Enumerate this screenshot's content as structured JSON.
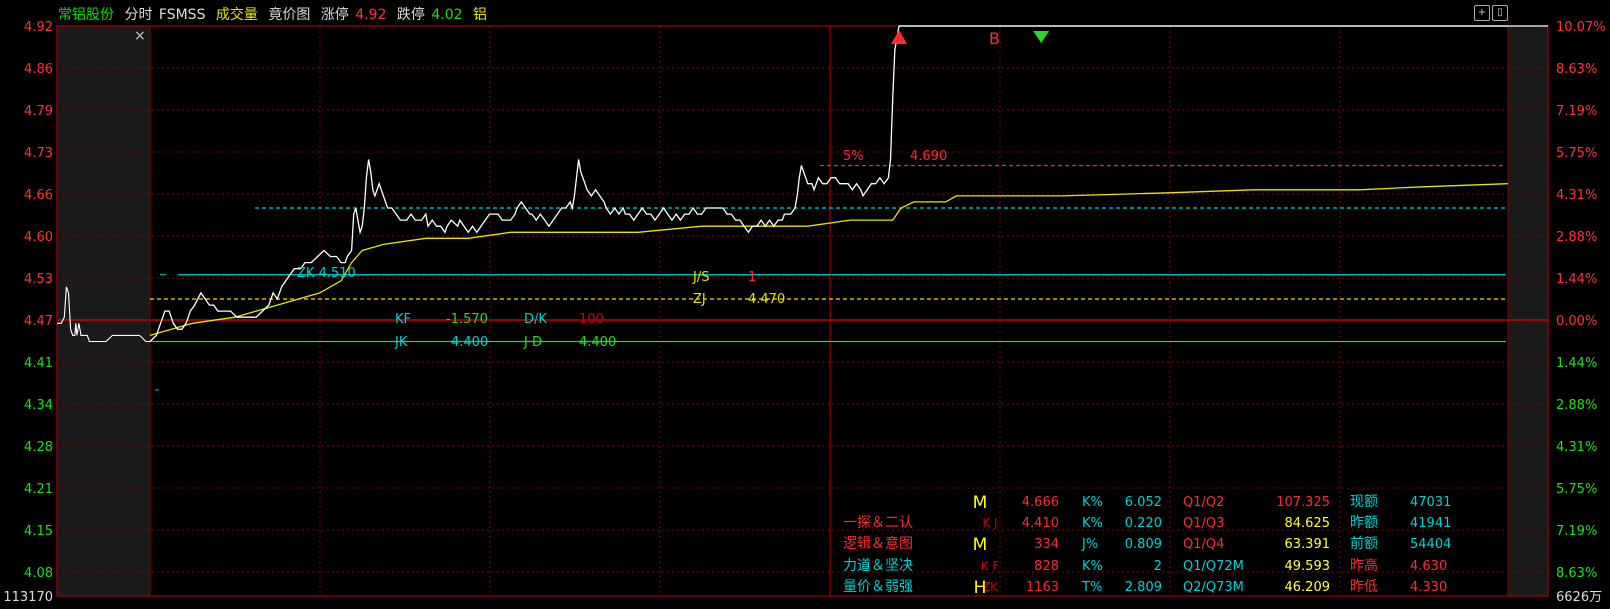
{
  "header": {
    "stock_name": "常铝股份",
    "mode": "分时",
    "indicator": "FSMSS",
    "volume_label": "成交量",
    "auction_label": "竟价图",
    "limit_up_label": "涨停",
    "limit_up_value": "4.92",
    "limit_down_label": "跌停",
    "limit_down_value": "4.02",
    "suffix": "铝"
  },
  "buttons": {
    "close": "×",
    "add": "+",
    "window": "▯"
  },
  "colors": {
    "background": "#000000",
    "grid": "#8b0000",
    "price_line": "#ffffff",
    "avg_line": "#e6e600",
    "up": "#ff2a2a",
    "down": "#22dd22",
    "cyan": "#00d2d2",
    "yellow": "#ffff44"
  },
  "chart_data": {
    "type": "line",
    "title": "",
    "xlabel": "",
    "ylabel": "",
    "prev_close": 4.47,
    "ylim": [
      4.02,
      4.92
    ],
    "left_ticks": [
      "4.92",
      "4.86",
      "4.79",
      "4.73",
      "4.66",
      "4.60",
      "4.53",
      "4.47",
      "4.41",
      "4.34",
      "4.28",
      "4.21",
      "4.15",
      "4.08",
      "113170"
    ],
    "right_ticks": [
      "10.07%",
      "8.63%",
      "7.19%",
      "5.75%",
      "4.31%",
      "2.88%",
      "1.44%",
      "0.00%",
      "1.44%",
      "2.88%",
      "4.31%",
      "5.75%",
      "7.19%",
      "8.63%",
      "6626万"
    ],
    "auction_series": [
      [
        0,
        4.43
      ],
      [
        4,
        4.43
      ],
      [
        7,
        4.44
      ],
      [
        9,
        4.49
      ],
      [
        11,
        4.48
      ],
      [
        13,
        4.42
      ],
      [
        15,
        4.41
      ],
      [
        17,
        4.41
      ],
      [
        18,
        4.43
      ],
      [
        19,
        4.41
      ],
      [
        21,
        4.43
      ],
      [
        23,
        4.41
      ],
      [
        25,
        4.41
      ],
      [
        27,
        4.41
      ],
      [
        29,
        4.41
      ],
      [
        31,
        4.4
      ],
      [
        35,
        4.4
      ],
      [
        38,
        4.4
      ],
      [
        41,
        4.4
      ],
      [
        44,
        4.4
      ],
      [
        47,
        4.4
      ],
      [
        53,
        4.41
      ],
      [
        60,
        4.41
      ],
      [
        65,
        4.41
      ],
      [
        70,
        4.41
      ],
      [
        75,
        4.41
      ],
      [
        79,
        4.41
      ],
      [
        85,
        4.4
      ],
      [
        89,
        4.4
      ]
    ],
    "price_series": [
      [
        0,
        4.4
      ],
      [
        3,
        4.41
      ],
      [
        5,
        4.43
      ],
      [
        7,
        4.45
      ],
      [
        9,
        4.45
      ],
      [
        11,
        4.43
      ],
      [
        13,
        4.42
      ],
      [
        15,
        4.42
      ],
      [
        17,
        4.43
      ],
      [
        19,
        4.45
      ],
      [
        21,
        4.46
      ],
      [
        24,
        4.48
      ],
      [
        26,
        4.47
      ],
      [
        28,
        4.46
      ],
      [
        30,
        4.46
      ],
      [
        32,
        4.45
      ],
      [
        35,
        4.45
      ],
      [
        38,
        4.45
      ],
      [
        41,
        4.44
      ],
      [
        44,
        4.44
      ],
      [
        47,
        4.44
      ],
      [
        50,
        4.44
      ],
      [
        53,
        4.45
      ],
      [
        56,
        4.46
      ],
      [
        58,
        4.48
      ],
      [
        60,
        4.47
      ],
      [
        62,
        4.49
      ],
      [
        64,
        4.5
      ],
      [
        66,
        4.51
      ],
      [
        68,
        4.52
      ],
      [
        71,
        4.52
      ],
      [
        73,
        4.53
      ],
      [
        76,
        4.53
      ],
      [
        79,
        4.54
      ],
      [
        82,
        4.55
      ],
      [
        85,
        4.54
      ],
      [
        88,
        4.54
      ],
      [
        90,
        4.53
      ],
      [
        92,
        4.53
      ],
      [
        93,
        4.54
      ],
      [
        95,
        4.55
      ],
      [
        96,
        4.61
      ],
      [
        97,
        4.62
      ],
      [
        98,
        4.6
      ],
      [
        99,
        4.58
      ],
      [
        100,
        4.59
      ],
      [
        101,
        4.62
      ],
      [
        102,
        4.67
      ],
      [
        103,
        4.7
      ],
      [
        104,
        4.68
      ],
      [
        105,
        4.65
      ],
      [
        106,
        4.64
      ],
      [
        108,
        4.66
      ],
      [
        110,
        4.64
      ],
      [
        112,
        4.62
      ],
      [
        114,
        4.62
      ],
      [
        116,
        4.61
      ],
      [
        118,
        4.6
      ],
      [
        121,
        4.6
      ],
      [
        123,
        4.61
      ],
      [
        125,
        4.6
      ],
      [
        128,
        4.6
      ],
      [
        130,
        4.61
      ],
      [
        131,
        4.59
      ],
      [
        133,
        4.6
      ],
      [
        135,
        4.59
      ],
      [
        137,
        4.59
      ],
      [
        139,
        4.58
      ],
      [
        140,
        4.59
      ],
      [
        142,
        4.6
      ],
      [
        145,
        4.59
      ],
      [
        146,
        4.6
      ],
      [
        148,
        4.59
      ],
      [
        150,
        4.58
      ],
      [
        152,
        4.59
      ],
      [
        154,
        4.58
      ],
      [
        156,
        4.59
      ],
      [
        158,
        4.6
      ],
      [
        160,
        4.61
      ],
      [
        162,
        4.61
      ],
      [
        164,
        4.61
      ],
      [
        166,
        4.6
      ],
      [
        168,
        4.6
      ],
      [
        170,
        4.6
      ],
      [
        172,
        4.61
      ],
      [
        173,
        4.62
      ],
      [
        175,
        4.63
      ],
      [
        177,
        4.62
      ],
      [
        179,
        4.61
      ],
      [
        180,
        4.61
      ],
      [
        182,
        4.6
      ],
      [
        184,
        4.61
      ],
      [
        186,
        4.6
      ],
      [
        188,
        4.59
      ],
      [
        190,
        4.6
      ],
      [
        192,
        4.61
      ],
      [
        194,
        4.62
      ],
      [
        196,
        4.62
      ],
      [
        198,
        4.63
      ],
      [
        199,
        4.62
      ],
      [
        200,
        4.64
      ],
      [
        201,
        4.67
      ],
      [
        202,
        4.7
      ],
      [
        203,
        4.68
      ],
      [
        205,
        4.66
      ],
      [
        206,
        4.65
      ],
      [
        208,
        4.64
      ],
      [
        210,
        4.65
      ],
      [
        212,
        4.64
      ],
      [
        214,
        4.63
      ],
      [
        215,
        4.62
      ],
      [
        217,
        4.61
      ],
      [
        219,
        4.62
      ],
      [
        221,
        4.61
      ],
      [
        223,
        4.62
      ],
      [
        224,
        4.61
      ],
      [
        226,
        4.61
      ],
      [
        228,
        4.6
      ],
      [
        230,
        4.61
      ],
      [
        232,
        4.62
      ],
      [
        234,
        4.61
      ],
      [
        236,
        4.61
      ],
      [
        238,
        4.6
      ],
      [
        240,
        4.61
      ],
      [
        242,
        4.62
      ],
      [
        244,
        4.61
      ],
      [
        246,
        4.6
      ],
      [
        248,
        4.61
      ],
      [
        250,
        4.6
      ],
      [
        252,
        4.61
      ],
      [
        254,
        4.61
      ],
      [
        256,
        4.62
      ],
      [
        258,
        4.61
      ],
      [
        260,
        4.61
      ],
      [
        262,
        4.62
      ],
      [
        264,
        4.62
      ],
      [
        266,
        4.62
      ],
      [
        268,
        4.62
      ],
      [
        270,
        4.62
      ],
      [
        272,
        4.61
      ],
      [
        274,
        4.61
      ],
      [
        276,
        4.6
      ],
      [
        278,
        4.6
      ],
      [
        280,
        4.59
      ],
      [
        282,
        4.58
      ],
      [
        284,
        4.59
      ],
      [
        286,
        4.59
      ],
      [
        288,
        4.6
      ],
      [
        290,
        4.59
      ],
      [
        292,
        4.6
      ],
      [
        294,
        4.59
      ],
      [
        296,
        4.6
      ],
      [
        298,
        4.6
      ],
      [
        299,
        4.61
      ],
      [
        300,
        4.61
      ],
      [
        302,
        4.61
      ],
      [
        304,
        4.62
      ],
      [
        305,
        4.64
      ],
      [
        306,
        4.67
      ],
      [
        307,
        4.69
      ],
      [
        308,
        4.68
      ],
      [
        309,
        4.67
      ],
      [
        310,
        4.66
      ],
      [
        312,
        4.66
      ],
      [
        313,
        4.65
      ],
      [
        315,
        4.67
      ],
      [
        317,
        4.66
      ],
      [
        319,
        4.66
      ],
      [
        321,
        4.67
      ],
      [
        323,
        4.67
      ],
      [
        325,
        4.66
      ],
      [
        327,
        4.66
      ],
      [
        329,
        4.66
      ],
      [
        331,
        4.65
      ],
      [
        333,
        4.66
      ],
      [
        335,
        4.65
      ],
      [
        336,
        4.64
      ],
      [
        338,
        4.65
      ],
      [
        340,
        4.66
      ],
      [
        342,
        4.66
      ],
      [
        344,
        4.67
      ],
      [
        346,
        4.66
      ],
      [
        348,
        4.67
      ],
      [
        349,
        4.7
      ],
      [
        350,
        4.8
      ],
      [
        351,
        4.88
      ],
      [
        352,
        4.9
      ],
      [
        353,
        4.92
      ],
      [
        360,
        4.92
      ],
      [
        400,
        4.92
      ],
      [
        480,
        4.92
      ],
      [
        600,
        4.92
      ],
      [
        640,
        4.92
      ]
    ],
    "avg_series": [
      [
        0,
        4.41
      ],
      [
        20,
        4.43
      ],
      [
        40,
        4.44
      ],
      [
        50,
        4.45
      ],
      [
        60,
        4.46
      ],
      [
        70,
        4.47
      ],
      [
        80,
        4.48
      ],
      [
        90,
        4.5
      ],
      [
        95,
        4.53
      ],
      [
        100,
        4.55
      ],
      [
        110,
        4.56
      ],
      [
        130,
        4.57
      ],
      [
        150,
        4.57
      ],
      [
        170,
        4.58
      ],
      [
        190,
        4.58
      ],
      [
        210,
        4.58
      ],
      [
        230,
        4.58
      ],
      [
        260,
        4.59
      ],
      [
        290,
        4.59
      ],
      [
        310,
        4.59
      ],
      [
        330,
        4.6
      ],
      [
        350,
        4.6
      ],
      [
        352,
        4.61
      ],
      [
        354,
        4.62
      ],
      [
        360,
        4.63
      ],
      [
        375,
        4.63
      ],
      [
        380,
        4.64
      ],
      [
        400,
        4.64
      ],
      [
        430,
        4.64
      ],
      [
        480,
        4.645
      ],
      [
        520,
        4.65
      ],
      [
        570,
        4.65
      ],
      [
        600,
        4.655
      ],
      [
        640,
        4.66
      ]
    ],
    "levels": [
      {
        "name": "5%",
        "value": 4.69,
        "label": "4.690",
        "color": "#ff2a2a",
        "style": "dashed"
      },
      {
        "name": "ZK",
        "value": 4.51,
        "label": "4.510",
        "color": "#00d2d2",
        "style": "solid"
      },
      {
        "name": "zero",
        "value": 4.47,
        "label": "",
        "color": "#ffdd00",
        "style": "dashed"
      },
      {
        "name": "JD",
        "value": 4.4,
        "label": "4.400",
        "color": "#22dd22",
        "style": "solid"
      },
      {
        "name": "cyan-upper",
        "value": 4.62,
        "label": "",
        "color": "#00d2d2",
        "style": "dashed"
      }
    ],
    "signals": [
      {
        "type": "up-triangle",
        "label": "",
        "x": 353
      },
      {
        "type": "text",
        "label": "B",
        "x": 398
      },
      {
        "type": "down-triangle",
        "label": "",
        "x": 420
      }
    ],
    "annotations": [
      {
        "label": "ZK",
        "value": "4.510"
      },
      {
        "label": "J/S",
        "value": "1"
      },
      {
        "label": "ZJ",
        "value": "4.470"
      },
      {
        "label": "KF",
        "value": "-1.570"
      },
      {
        "label": "D/K",
        "value": "100"
      },
      {
        "label": "JK",
        "value": "4.400"
      },
      {
        "label": "J D",
        "value": "4.400"
      },
      {
        "label": "5%",
        "value": "4.690"
      }
    ],
    "x_range": [
      0,
      640
    ],
    "auction_x_range": [
      0,
      89
    ]
  },
  "info_panel": {
    "rows": [
      {
        "mark": "M",
        "left": "",
        "c1": "4.666",
        "k1": "K%",
        "v1": "6.052",
        "k2": "Q1/Q2",
        "v2": "107.325",
        "k3": "现额",
        "v3": "47031"
      },
      {
        "mark": "",
        "left": "一探＆二认",
        "c1": "4.410",
        "k1": "K%",
        "v1": "0.220",
        "k2": "Q1/Q3",
        "v2": "84.625",
        "k3": "昨额",
        "v3": "41941",
        "klbl": "K J"
      },
      {
        "mark": "M",
        "left": "逻辑＆意图",
        "c1": "334",
        "k1": "J%",
        "v1": "0.809",
        "k2": "Q1/Q4",
        "v2": "63.391",
        "k3": "前额",
        "v3": "54404"
      },
      {
        "mark": "",
        "left": "力道＆坚决",
        "c1": "828",
        "k1": "K%",
        "v1": "2",
        "k2": "Q1/Q72M",
        "v2": "49.593",
        "k3": "昨高",
        "v3": "4.630",
        "klbl": "K F"
      },
      {
        "mark": "H",
        "left": "量价＆弱强",
        "c1": "1163",
        "k1": "T%",
        "v1": "2.809",
        "k2": "Q2/Q73M",
        "v2": "46.209",
        "k3": "昨低",
        "v3": "4.330",
        "klbl": "ZK"
      }
    ]
  }
}
